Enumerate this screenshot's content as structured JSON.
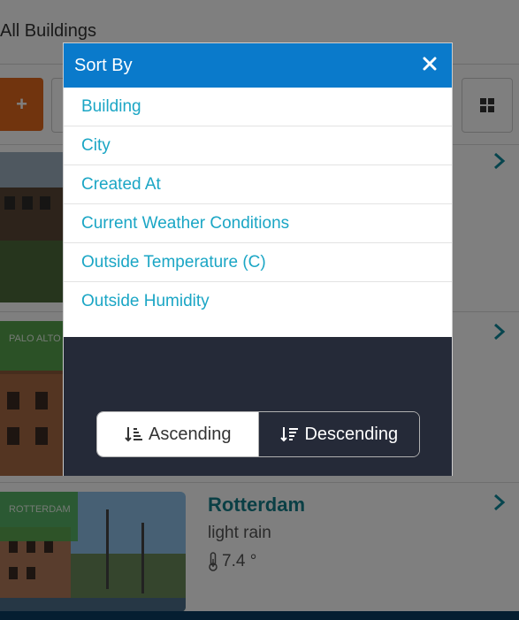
{
  "page": {
    "title": "All Buildings"
  },
  "toolbar": {
    "add_icon": "plus-icon",
    "view_icon": "grid-icon"
  },
  "cards": [
    {
      "city_tag": "",
      "city": "",
      "weather": "",
      "temp": ""
    },
    {
      "city_tag": "PALO ALTO",
      "city": "",
      "weather": "",
      "temp": ""
    },
    {
      "city_tag": "ROTTERDAM",
      "city": "Rotterdam",
      "weather": "light rain",
      "temp": "7.4 °"
    }
  ],
  "modal": {
    "title": "Sort By",
    "close_icon": "close-icon",
    "options": [
      "Building",
      "City",
      "Created At",
      "Current Weather Conditions",
      "Outside Temperature (C)",
      "Outside Humidity"
    ],
    "order": {
      "ascending_label": "Ascending",
      "descending_label": "Descending",
      "selected": "Descending"
    }
  },
  "colors": {
    "header_blue": "#0a7acb",
    "link_teal": "#1ba6c5",
    "footer_dark": "#252a38",
    "add_orange": "#e2691d",
    "city_teal": "#147f8a"
  }
}
